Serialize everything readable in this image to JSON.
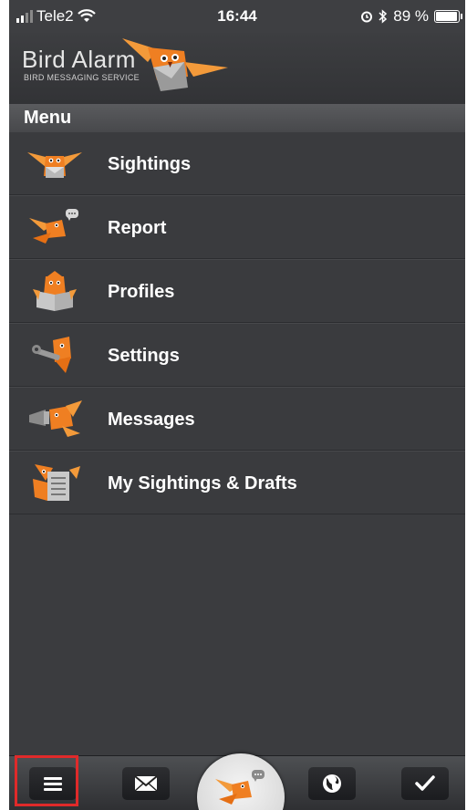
{
  "status_bar": {
    "carrier": "Tele2",
    "time": "16:44",
    "battery": "89 %",
    "alarm_icon": "alarm-clock-icon",
    "bluetooth_icon": "bluetooth-icon",
    "wifi_icon": "wifi-icon"
  },
  "header": {
    "brand_name": "Bird Alarm",
    "brand_subtitle": "BIRD MESSAGING SERVICE"
  },
  "menu": {
    "title": "Menu",
    "items": [
      {
        "label": "Sightings",
        "icon": "bird-flying-icon"
      },
      {
        "label": "Report",
        "icon": "bird-speech-icon"
      },
      {
        "label": "Profiles",
        "icon": "bird-book-icon"
      },
      {
        "label": "Settings",
        "icon": "bird-wrench-icon"
      },
      {
        "label": "Messages",
        "icon": "bird-megaphone-icon"
      },
      {
        "label": "My Sightings & Drafts",
        "icon": "bird-list-icon"
      }
    ]
  },
  "tabbar": {
    "items": [
      {
        "name": "menu",
        "icon": "hamburger-icon",
        "selected": true
      },
      {
        "name": "messages",
        "icon": "envelope-icon"
      },
      {
        "name": "report",
        "icon": "bird-speech-icon"
      },
      {
        "name": "map",
        "icon": "globe-icon"
      },
      {
        "name": "done",
        "icon": "checkmark-icon"
      }
    ]
  },
  "colors": {
    "background": "#3b3c3f",
    "accent_orange": "#f07f22",
    "highlight_red": "#e02a2a",
    "text": "#ffffff"
  }
}
